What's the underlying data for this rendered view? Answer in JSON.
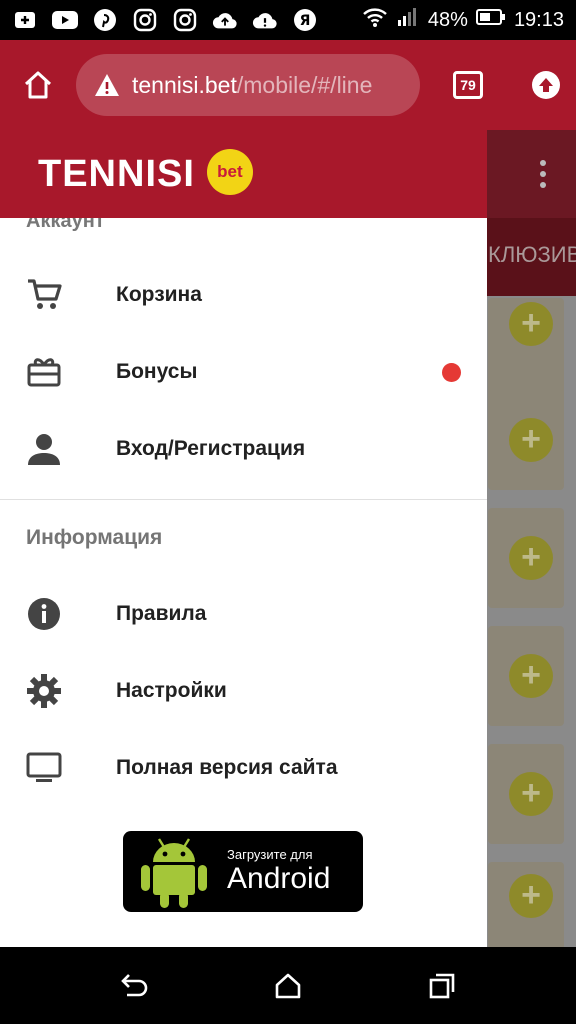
{
  "status_bar": {
    "battery_percent": "48%",
    "time": "19:13",
    "notification_icons": [
      "add-icon",
      "youtube-icon",
      "pinterest-icon",
      "instagram-icon",
      "instagram-icon",
      "cloud-upload-icon",
      "cloud-alert-icon",
      "yandex-icon"
    ],
    "yandex_letter": "Я"
  },
  "browser": {
    "url_host": "tennisi.bet",
    "url_path": "/mobile/#/line",
    "tab_count": "79"
  },
  "page": {
    "tab_label": "КЛЮЗИВ",
    "plus_symbol": "+"
  },
  "drawer": {
    "logo_text": "TENNISI",
    "logo_badge": "bet",
    "account_section": "Аккаунт",
    "account_items": [
      {
        "label": "Корзина",
        "icon": "cart-icon"
      },
      {
        "label": "Бонусы",
        "icon": "gift-icon",
        "badge": "red-dot"
      },
      {
        "label": "Вход/Регистрация",
        "icon": "person-icon"
      }
    ],
    "info_section": "Информация",
    "info_items": [
      {
        "label": "Правила",
        "icon": "info-icon"
      },
      {
        "label": "Настройки",
        "icon": "gear-icon"
      },
      {
        "label": "Полная версия сайта",
        "icon": "monitor-icon"
      }
    ],
    "store_small": "Загрузите для",
    "store_big": "Android"
  },
  "colors": {
    "brand_red": "#a8182b",
    "badge_yellow": "#f2d415",
    "notify_red": "#e53935"
  }
}
